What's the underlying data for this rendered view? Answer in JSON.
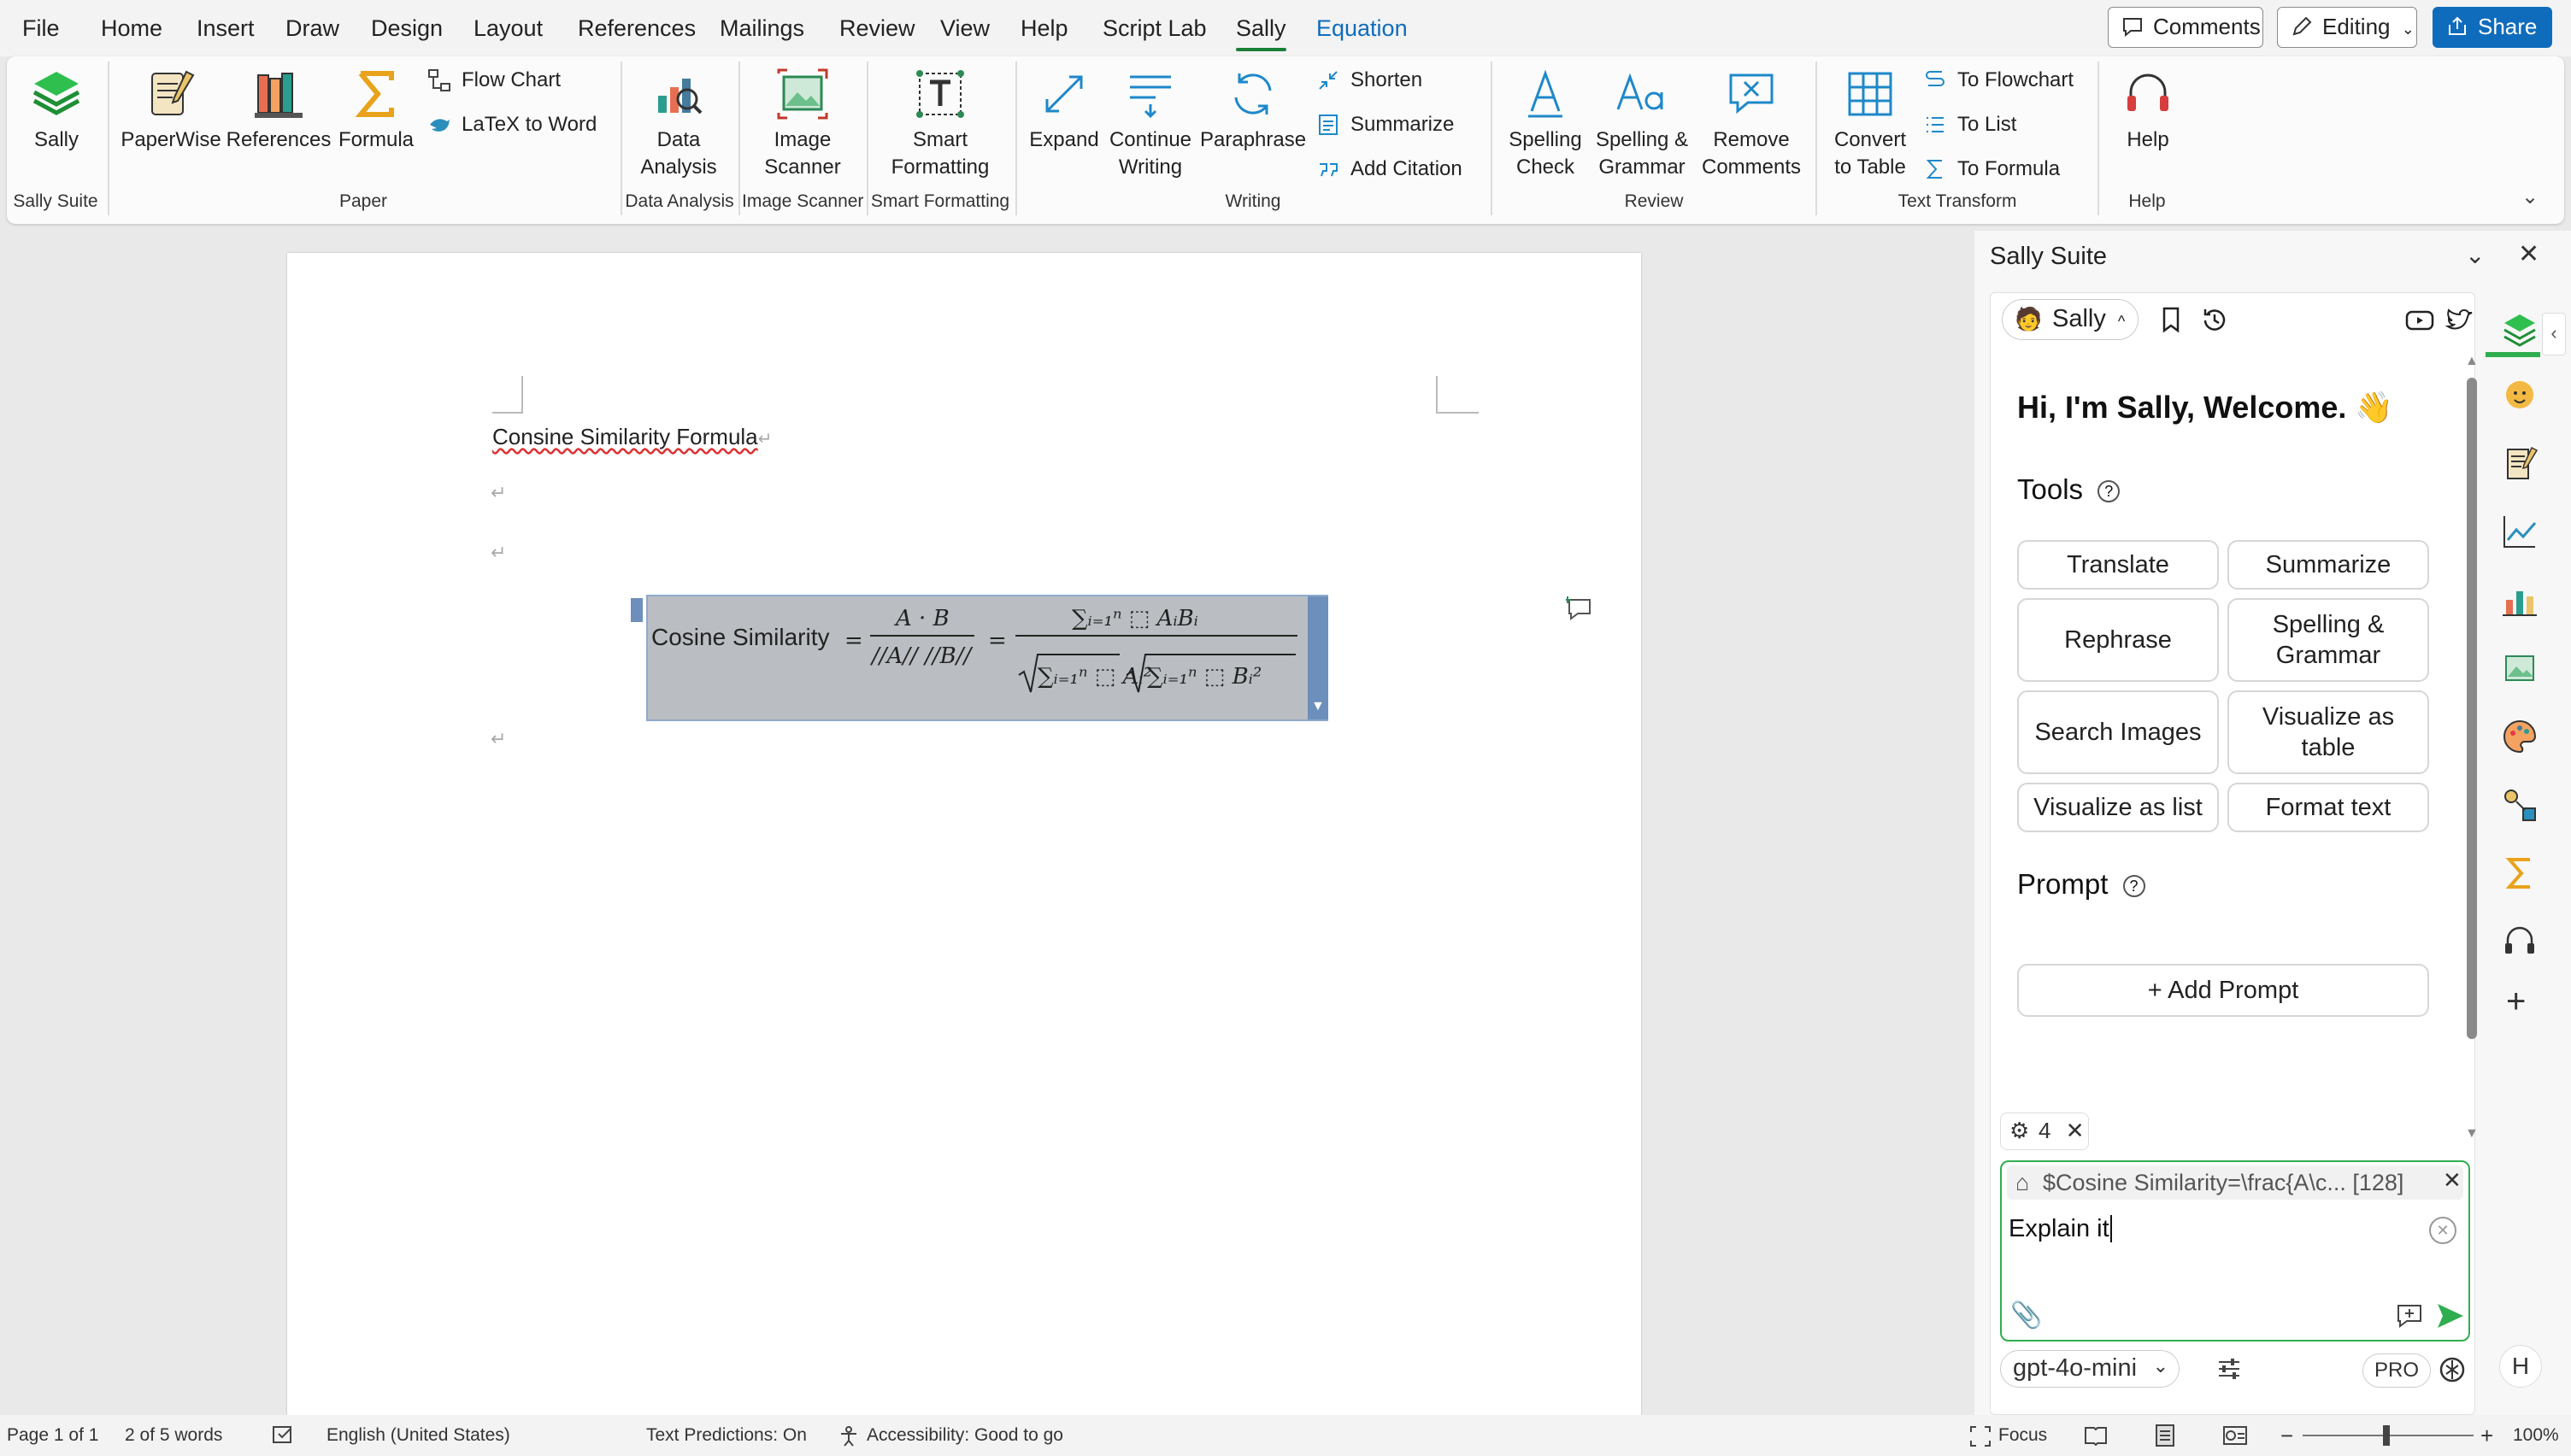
{
  "menubar": {
    "items": [
      "File",
      "Home",
      "Insert",
      "Draw",
      "Design",
      "Layout",
      "References",
      "Mailings",
      "Review",
      "View",
      "Help",
      "Script Lab",
      "Sally",
      "Equation"
    ],
    "comments": "Comments",
    "editing": "Editing",
    "share": "Share"
  },
  "ribbon": {
    "sally": "Sally",
    "paperwise": "PaperWise",
    "references": "References",
    "formula": "Formula",
    "flowchart": "Flow Chart",
    "latex": "LaTeX to Word",
    "data1": "Data",
    "data2": "Analysis",
    "img1": "Image",
    "img2": "Scanner",
    "smart1": "Smart",
    "smart2": "Formatting",
    "expand": "Expand",
    "cont1": "Continue",
    "cont2": "Writing",
    "paraphrase": "Paraphrase",
    "shorten": "Shorten",
    "summarize": "Summarize",
    "citation": "Add Citation",
    "spell1": "Spelling",
    "spell2": "Check",
    "sg1": "Spelling &",
    "sg2": "Grammar",
    "rc1": "Remove",
    "rc2": "Comments",
    "ct1": "Convert",
    "ct2": "to Table",
    "toflow": "To Flowchart",
    "tolist": "To List",
    "toformula": "To Formula",
    "help": "Help",
    "groups": {
      "sally": "Sally Suite",
      "paper": "Paper",
      "data": "Data Analysis",
      "image": "Image Scanner",
      "smart": "Smart Formatting",
      "writing": "Writing",
      "review": "Review",
      "transform": "Text Transform",
      "help": "Help"
    }
  },
  "doc": {
    "heading": "Consine Similarity Formula",
    "eq_label": "Cosine Similarity"
  },
  "status": {
    "page": "Page 1 of 1",
    "words": "2 of 5 words",
    "lang": "English (United States)",
    "pred": "Text Predictions: On",
    "access": "Accessibility: Good to go",
    "focus": "Focus",
    "zoom": "100%"
  },
  "panel": {
    "title": "Sally Suite",
    "tab": "Sally",
    "welcome": "Hi, I'm Sally, Welcome.",
    "tools": "Tools",
    "buttons": {
      "translate": "Translate",
      "summarize": "Summarize",
      "rephrase": "Rephrase",
      "sg1": "Spelling &",
      "sg2": "Grammar",
      "search": "Search Images",
      "vt1": "Visualize as",
      "vt2": "table",
      "vl": "Visualize as list",
      "format": "Format text"
    },
    "prompt": "Prompt",
    "add_prompt": "+ Add Prompt",
    "settings_count": "4",
    "context": "$Cosine Similarity=\\frac{A\\c... [128]",
    "input": "Explain it",
    "model": "gpt-4o-mini",
    "pro": "PRO",
    "avatar": "H"
  }
}
